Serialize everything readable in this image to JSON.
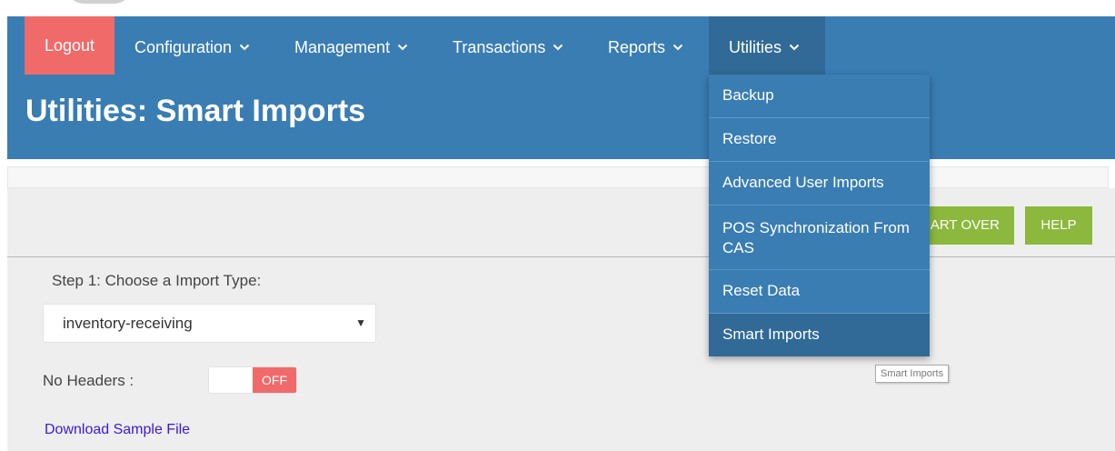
{
  "navbar": {
    "logout": "Logout",
    "items": [
      {
        "label": "Configuration",
        "chevron": "⌄"
      },
      {
        "label": "Management",
        "chevron": "⌄"
      },
      {
        "label": "Transactions",
        "chevron": "⌄"
      },
      {
        "label": "Reports",
        "chevron": "⌄"
      },
      {
        "label": "Utilities",
        "chevron": "⌄"
      }
    ]
  },
  "utilities_menu": {
    "items": [
      "Backup",
      "Restore",
      "Advanced User Imports",
      "POS Synchronization From CAS",
      "Reset Data",
      "Smart Imports"
    ],
    "active_item": "Smart Imports"
  },
  "page": {
    "title": "Utilities: Smart Imports"
  },
  "toolbar": {
    "start_over": "ART OVER",
    "help": "HELP"
  },
  "form": {
    "step1_label": "Step 1: Choose a Import Type:",
    "import_type_value": "inventory-receiving",
    "dropdown_arrow": "▼",
    "no_headers_label": "No Headers :",
    "no_headers_toggle": "OFF",
    "download_link": "Download Sample File"
  },
  "tooltip": "Smart Imports",
  "colors": {
    "nav_blue": "#3a7db3",
    "nav_active": "#316a97",
    "logout_red": "#f06a6a",
    "button_green": "#8cb83d",
    "link_blue": "#3d18d6"
  }
}
